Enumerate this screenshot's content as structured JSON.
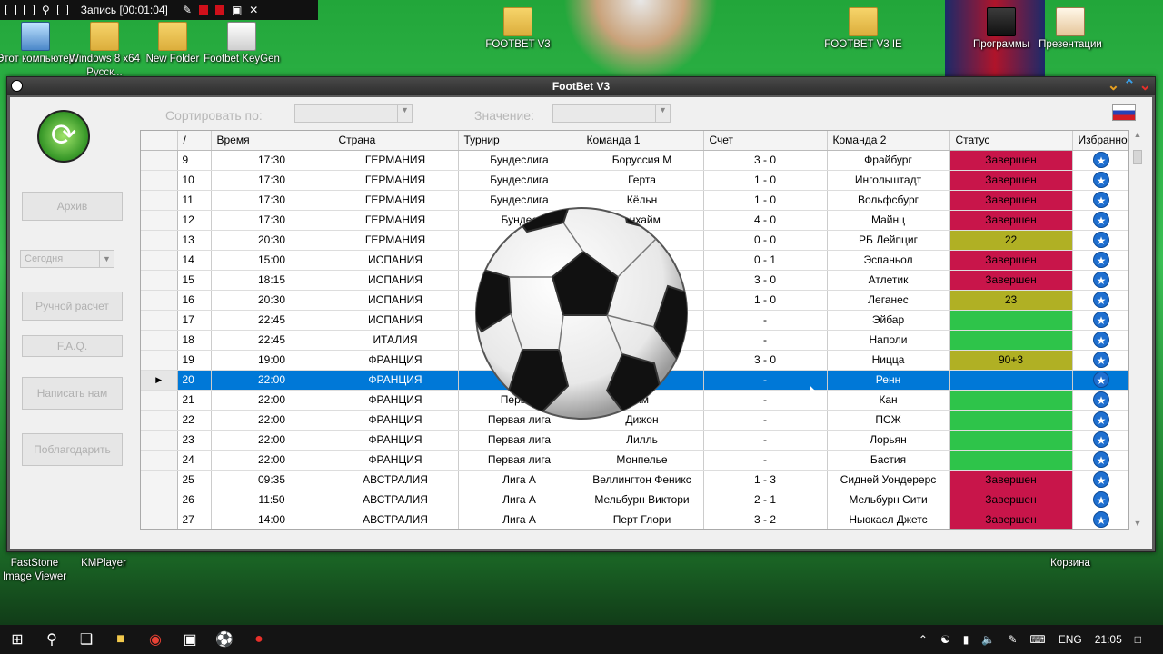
{
  "recorder": {
    "label": "Запись [00:01:04]"
  },
  "desktop_icons": [
    {
      "label": "Этот компьютер"
    },
    {
      "label": "Windows 8 x64 Русск..."
    },
    {
      "label": "New Folder"
    },
    {
      "label": "Footbet KeyGen"
    },
    {
      "label": "FOOTBET V3"
    },
    {
      "label": "FOOTBET V3 IE"
    },
    {
      "label": "Программы"
    },
    {
      "label": "Презентации"
    },
    {
      "label": "FastStone Image Viewer"
    },
    {
      "label": "KMPlayer"
    },
    {
      "label": "Корзина"
    }
  ],
  "window": {
    "title": "FootBet V3"
  },
  "toolbar": {
    "sort_label": "Сортировать по:",
    "value_label": "Значение:"
  },
  "sidebar": {
    "archive": "Архив",
    "date_select": "Сегодня",
    "manual": "Ручной расчет",
    "faq": "F.A.Q.",
    "write": "Написать нам",
    "thank": "Поблагодарить"
  },
  "columns": [
    "/",
    "Время",
    "Страна",
    "Турнир",
    "Команда 1",
    "Счет",
    "Команда 2",
    "Статус",
    "Избранное"
  ],
  "rows": [
    {
      "n": "9",
      "time": "17:30",
      "country": "ГЕРМАНИЯ",
      "league": "Бундеслига",
      "team1": "Боруссия М",
      "score": "3 - 0",
      "team2": "Фрайбург",
      "status": "Завершен",
      "sc": "red"
    },
    {
      "n": "10",
      "time": "17:30",
      "country": "ГЕРМАНИЯ",
      "league": "Бундеслига",
      "team1": "Герта",
      "score": "1 - 0",
      "team2": "Ингольштадт",
      "status": "Завершен",
      "sc": "red"
    },
    {
      "n": "11",
      "time": "17:30",
      "country": "ГЕРМАНИЯ",
      "league": "Бундеслига",
      "team1": "Кёльн",
      "score": "1 - 0",
      "team2": "Вольфсбург",
      "status": "Завершен",
      "sc": "red"
    },
    {
      "n": "12",
      "time": "17:30",
      "country": "ГЕРМАНИЯ",
      "league": "Бундес",
      "team1": "енхайм",
      "score": "4 - 0",
      "team2": "Майнц",
      "status": "Завершен",
      "sc": "red"
    },
    {
      "n": "13",
      "time": "20:30",
      "country": "ГЕРМАНИЯ",
      "league": "Бу",
      "team1": "Л",
      "score": "0 - 0",
      "team2": "РБ Лейпциг",
      "status": "22",
      "sc": "olive"
    },
    {
      "n": "14",
      "time": "15:00",
      "country": "ИСПАНИЯ",
      "league": "",
      "team1": "",
      "score": "0 - 1",
      "team2": "Эспаньол",
      "status": "Завершен",
      "sc": "red"
    },
    {
      "n": "15",
      "time": "18:15",
      "country": "ИСПАНИЯ",
      "league": "",
      "team1": "",
      "score": "3 - 0",
      "team2": "Атлетик",
      "status": "Завершен",
      "sc": "red"
    },
    {
      "n": "16",
      "time": "20:30",
      "country": "ИСПАНИЯ",
      "league": "",
      "team1": "",
      "score": "1 - 0",
      "team2": "Леганес",
      "status": "23",
      "sc": "olive"
    },
    {
      "n": "17",
      "time": "22:45",
      "country": "ИСПАНИЯ",
      "league": "",
      "team1": "",
      "score": "-",
      "team2": "Эйбар",
      "status": "",
      "sc": "green"
    },
    {
      "n": "18",
      "time": "22:45",
      "country": "ИТАЛИЯ",
      "league": "",
      "team1": "",
      "score": "-",
      "team2": "Наполи",
      "status": "",
      "sc": "green"
    },
    {
      "n": "19",
      "time": "19:00",
      "country": "ФРАНЦИЯ",
      "league": "",
      "team1": "",
      "score": "3 - 0",
      "team2": "Ницца",
      "status": "90+3",
      "sc": "olive"
    },
    {
      "n": "20",
      "time": "22:00",
      "country": "ФРАНЦИЯ",
      "league": "Пе",
      "team1": "",
      "score": "-",
      "team2": "Ренн",
      "status": "",
      "sc": "sel"
    },
    {
      "n": "21",
      "time": "22:00",
      "country": "ФРАНЦИЯ",
      "league": "Первая",
      "team1": "ам",
      "score": "-",
      "team2": "Кан",
      "status": "",
      "sc": "green"
    },
    {
      "n": "22",
      "time": "22:00",
      "country": "ФРАНЦИЯ",
      "league": "Первая лига",
      "team1": "Дижон",
      "score": "-",
      "team2": "ПСЖ",
      "status": "",
      "sc": "green"
    },
    {
      "n": "23",
      "time": "22:00",
      "country": "ФРАНЦИЯ",
      "league": "Первая лига",
      "team1": "Лилль",
      "score": "-",
      "team2": "Лорьян",
      "status": "",
      "sc": "green"
    },
    {
      "n": "24",
      "time": "22:00",
      "country": "ФРАНЦИЯ",
      "league": "Первая лига",
      "team1": "Монпелье",
      "score": "-",
      "team2": "Бастия",
      "status": "",
      "sc": "green"
    },
    {
      "n": "25",
      "time": "09:35",
      "country": "АВСТРАЛИЯ",
      "league": "Лига А",
      "team1": "Веллингтон Феникс",
      "score": "1 - 3",
      "team2": "Сидней Уондерерс",
      "status": "Завершен",
      "sc": "red"
    },
    {
      "n": "26",
      "time": "11:50",
      "country": "АВСТРАЛИЯ",
      "league": "Лига А",
      "team1": "Мельбурн Виктори",
      "score": "2 - 1",
      "team2": "Мельбурн Сити",
      "status": "Завершен",
      "sc": "red"
    },
    {
      "n": "27",
      "time": "14:00",
      "country": "АВСТРАЛИЯ",
      "league": "Лига А",
      "team1": "Перт Глори",
      "score": "3 - 2",
      "team2": "Ньюкасл Джетс",
      "status": "Завершен",
      "sc": "red"
    }
  ],
  "taskbar": {
    "lang": "ENG",
    "time": "21:05"
  }
}
